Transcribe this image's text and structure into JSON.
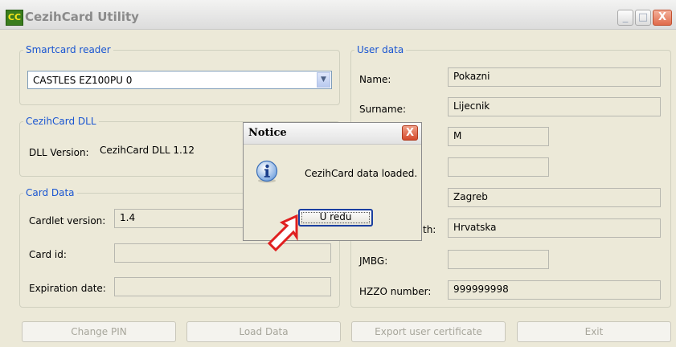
{
  "window": {
    "title": "CezihCard Utility",
    "icon": "CC",
    "minimize": "_",
    "maximize": "□",
    "close": "X"
  },
  "smartcard_reader": {
    "legend": "Smartcard reader",
    "selected": "CASTLES EZ100PU 0",
    "arrow": "▼"
  },
  "dll": {
    "legend": "CezihCard DLL",
    "version_label": "DLL Version:",
    "version_value": "CezihCard DLL 1.12"
  },
  "card_data": {
    "legend": "Card Data",
    "cardlet_label": "Cardlet version:",
    "cardlet_value": "1.4",
    "card_id_label": "Card id:",
    "card_id_value": "",
    "expiration_label": "Expiration date:",
    "expiration_value": ""
  },
  "user_data": {
    "legend": "User data",
    "name_label": "Name:",
    "name_value": "Pokazni",
    "surname_label": "Surname:",
    "surname_value": "Lijecnik",
    "sex_value": "M",
    "row4_value": "",
    "city_value": "Zagreb",
    "birth_label_fragment": "th:",
    "birth_value": "Hrvatska",
    "jmbg_label": "JMBG:",
    "jmbg_value": "",
    "hzzo_label": "HZZO number:",
    "hzzo_value": "999999998"
  },
  "buttons": {
    "change_pin": "Change PIN",
    "load_data": "Load Data",
    "export_cert": "Export user certificate",
    "exit": "Exit"
  },
  "dialog": {
    "title": "Notice",
    "close": "X",
    "message": "CezihCard data loaded.",
    "ok": "U redu"
  },
  "colors": {
    "legend_text": "#1955d1",
    "dialog_close": "#d4492b",
    "ok_border": "#1b3fa0",
    "pointer_arrow": "#e02020"
  }
}
